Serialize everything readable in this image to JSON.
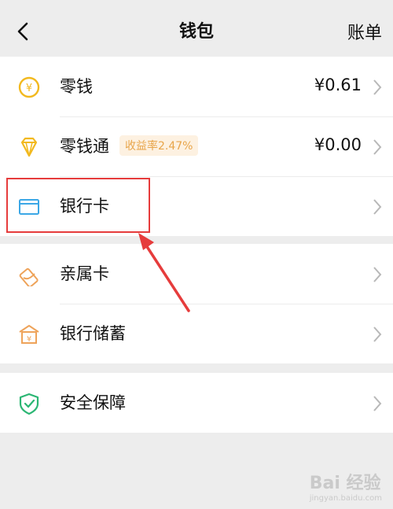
{
  "header": {
    "title": "钱包",
    "right_link": "账单"
  },
  "wallet_rows": [
    {
      "label": "零钱",
      "value": "¥0.61"
    },
    {
      "label": "零钱通",
      "badge": "收益率2.47%",
      "value": "¥0.00"
    },
    {
      "label": "银行卡"
    }
  ],
  "card_rows": [
    {
      "label": "亲属卡"
    },
    {
      "label": "银行储蓄"
    }
  ],
  "security_rows": [
    {
      "label": "安全保障"
    }
  ],
  "colors": {
    "accent_yellow": "#f2b91f",
    "bank_blue": "#3ba7e6",
    "savings_orange": "#eea35a",
    "security_green": "#2bb673",
    "highlight_red": "#e63c3c"
  },
  "watermark": {
    "text": "Bai 经验",
    "url": "jingyan.baidu.com"
  }
}
